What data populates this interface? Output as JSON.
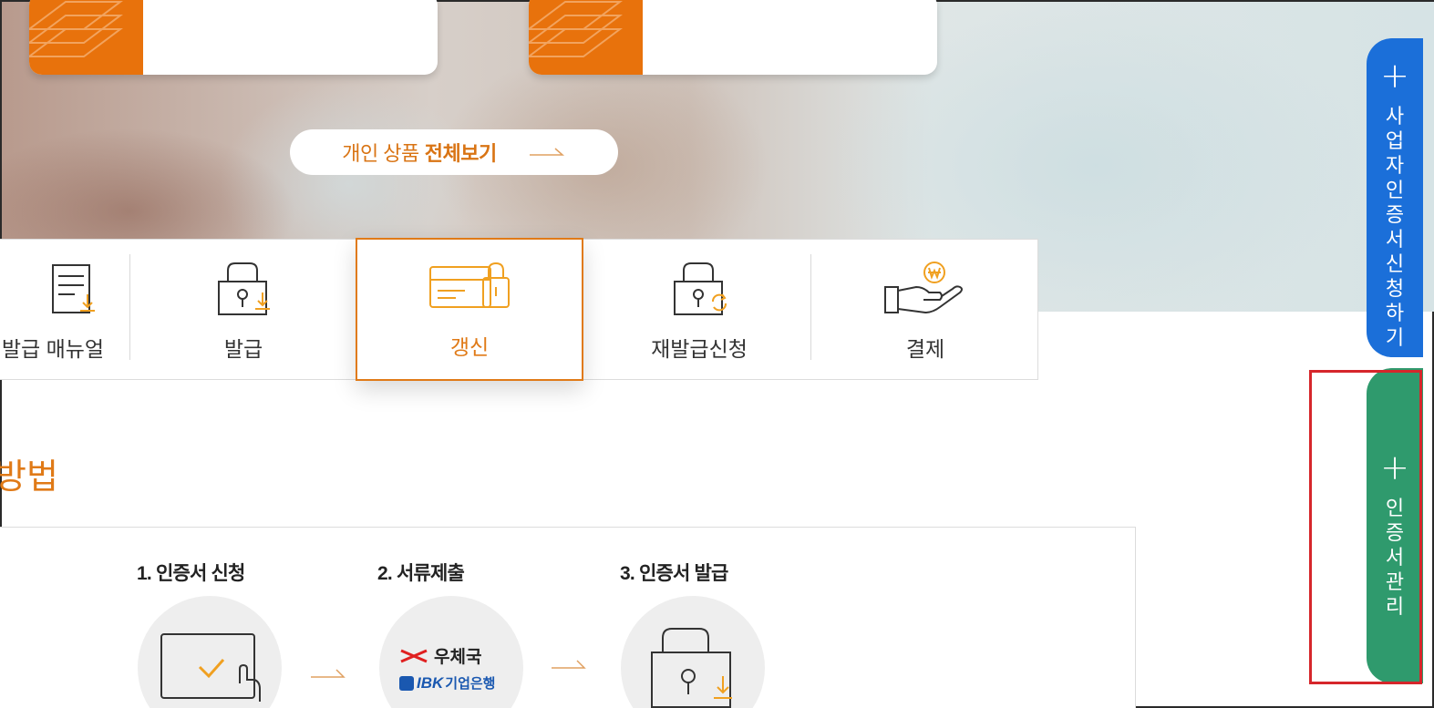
{
  "hero": {
    "view_all_prefix": "개인 상품",
    "view_all_bold": "전체보기",
    "colors": {
      "accent": "#e8720c"
    }
  },
  "menu": {
    "items": [
      {
        "label": "발급 매뉴얼",
        "icon": "manual-document-icon"
      },
      {
        "label": "발급",
        "icon": "lock-download-icon"
      },
      {
        "label": "갱신",
        "icon": "card-lock-icon",
        "active": true
      },
      {
        "label": "재발급신청",
        "icon": "lock-refresh-icon"
      },
      {
        "label": "결제",
        "icon": "hand-coin-icon"
      }
    ]
  },
  "section": {
    "title": "방법"
  },
  "process": {
    "steps": [
      {
        "label": "1. 인증서 신청",
        "icon": "monitor-check-icon"
      },
      {
        "label": "2. 서류제출",
        "icon": "post-bank-logos-icon",
        "logo1": "우체국",
        "logo2_brand": "IBK",
        "logo2_text": "기업은행"
      },
      {
        "label": "3. 인증서 발급",
        "icon": "lock-download-icon"
      }
    ]
  },
  "side": {
    "business_cert": "사업자인증서 신청하기",
    "cert_manage": "인증서 관리",
    "colors": {
      "business": "#1b6fd9",
      "manage": "#2f9a6d",
      "highlight": "#d6262b"
    }
  }
}
